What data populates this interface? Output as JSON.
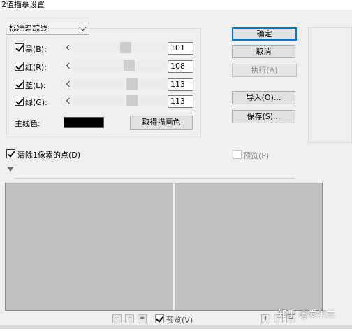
{
  "window": {
    "title": "2值描摹设置"
  },
  "mode_select": {
    "value": "标准追踪线"
  },
  "sliders": [
    {
      "label": "黑(B):",
      "value": "101",
      "checked": true,
      "level": 0.56
    },
    {
      "label": "红(R):",
      "value": "108",
      "checked": true,
      "level": 0.6
    },
    {
      "label": "蓝(L):",
      "value": "113",
      "checked": true,
      "level": 0.63
    },
    {
      "label": "绿(G):",
      "value": "113",
      "checked": true,
      "level": 0.63
    }
  ],
  "main_color": {
    "label": "主线色:",
    "color": "#000000",
    "pick_button": "取得描画色"
  },
  "buttons": {
    "ok": "确定",
    "cancel": "取消",
    "execute": "执行(A)",
    "import": "导入(O)...",
    "save": "保存(S)..."
  },
  "options": {
    "remove_1px": {
      "label": "清除1像素的点(D)",
      "checked": true
    },
    "preview": {
      "label": "预览(P)",
      "checked": false,
      "disabled": true
    }
  },
  "preview_area": {
    "background": "#c0c0c0",
    "zoom_in": "+",
    "zoom_out": "−",
    "fit": "=",
    "preview_label": "预览(V)",
    "preview_checked": true
  },
  "watermark": "知乎 @爱尔兰"
}
